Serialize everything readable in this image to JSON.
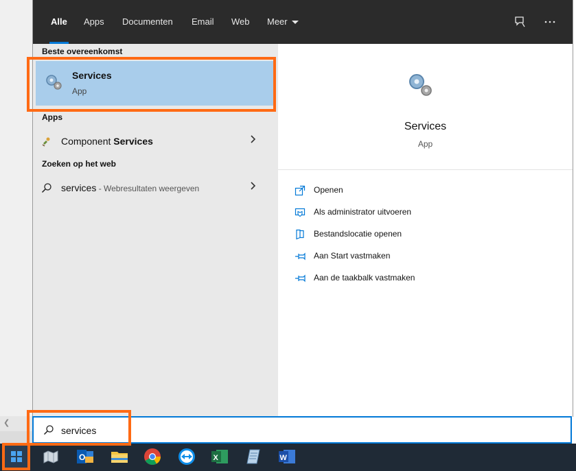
{
  "tabs": [
    {
      "label": "Alle"
    },
    {
      "label": "Apps"
    },
    {
      "label": "Documenten"
    },
    {
      "label": "Email"
    },
    {
      "label": "Web"
    },
    {
      "label": "Meer"
    }
  ],
  "toolbar": {
    "feedback_icon": "feedback-icon",
    "more_icon": "more-icon"
  },
  "left": {
    "best_header": "Beste overeenkomst",
    "best": {
      "name": "Services",
      "type": "App"
    },
    "apps_header": "Apps",
    "app_item": {
      "label_prefix": "Component ",
      "label_bold": "Services"
    },
    "web_header": "Zoeken op het web",
    "web_item": {
      "label": "services",
      "hint": " - Webresultaten weergeven"
    }
  },
  "right": {
    "title": "Services",
    "subtitle": "App",
    "actions": [
      {
        "label": "Openen",
        "icon": "open-icon"
      },
      {
        "label": "Als administrator uitvoeren",
        "icon": "shield-icon"
      },
      {
        "label": "Bestandslocatie openen",
        "icon": "file-location-icon"
      },
      {
        "label": "Aan Start vastmaken",
        "icon": "pin-icon"
      },
      {
        "label": "Aan de taakbalk vastmaken",
        "icon": "pin-icon"
      }
    ]
  },
  "search": {
    "value": "services"
  },
  "colors": {
    "accent": "#0078d7",
    "highlight": "#ff6a14",
    "selected": "#a9cdeb",
    "tabbar": "#2b2b2b",
    "taskbar": "#1f2a36"
  }
}
